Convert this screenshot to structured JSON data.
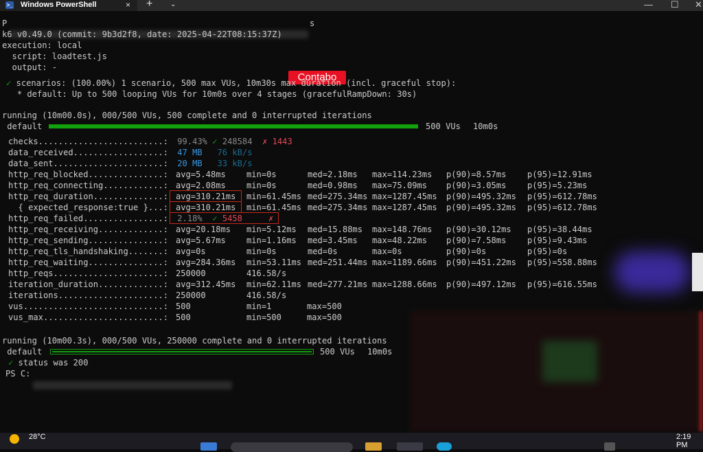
{
  "window": {
    "tab_title": "Windows PowerShell",
    "tab_close": "×",
    "new_tab": "+",
    "tab_menu": "⌄",
    "minimize": "—",
    "maximize": "☐",
    "close": "✕"
  },
  "header": {
    "prompt_partial": "P",
    "cmd_tail": "s",
    "version": "k6 v0.49.0 (commit: 9b3d2f8, date: 2025-04-22T08:15:37Z)",
    "execution": "execution: local",
    "script": "  script: loadtest.js",
    "output": "  output: -",
    "label": "Contabo"
  },
  "scenarios": {
    "check": "✓",
    "line": " scenarios: (100.00%) 1 scenario, 500 max VUs, 10m30s max duration (incl. graceful stop):",
    "default": "   * default: Up to 500 looping VUs for 10m0s over 4 stages (gracefulRampDown: 30s)"
  },
  "progress1": {
    "running": "running (10m00.0s), 000/500 VUs, 500 complete and 0 interrupted iterations",
    "label": " default",
    "vus": "500 VUs",
    "time": "10m0s"
  },
  "metrics": {
    "checks": {
      "name": "checks.........................: ",
      "pct": "99.43%",
      "ok": "✓",
      "pass": "248584",
      "fail_mark": "✗",
      "fail": "1443"
    },
    "data_received": {
      "name": "data_received..................: ",
      "amount": "47 MB",
      "rate": "76 kB/s"
    },
    "data_sent": {
      "name": "data_sent......................: ",
      "amount": "20 MB",
      "rate": "33 kB/s"
    },
    "rows": [
      {
        "name": "http_req_blocked...............: ",
        "avg": "avg=5.48ms",
        "min": "min=0s",
        "med": "med=2.18ms",
        "max": "max=114.23ms",
        "p90": "p(90)=8.57ms",
        "p95": "p(95)=12.91ms"
      },
      {
        "name": "http_req_connecting............: ",
        "avg": "avg=2.08ms",
        "min": "min=0s",
        "med": "med=0.98ms",
        "max": "max=75.09ms",
        "p90": "p(90)=3.05ms",
        "p95": "p(95)=5.23ms"
      },
      {
        "name": "http_req_duration..............: ",
        "avg": "avg=310.21ms",
        "min": "min=61.45ms",
        "med": "med=275.34ms",
        "max": "max=1287.45ms",
        "p90": "p(90)=495.32ms",
        "p95": "p(95)=612.78ms"
      },
      {
        "name": "  { expected_response:true }...: ",
        "avg": "avg=310.21ms",
        "min": "min=61.45ms",
        "med": "med=275.34ms",
        "max": "max=1287.45ms",
        "p90": "p(90)=495.32ms",
        "p95": "p(95)=612.78ms"
      }
    ],
    "failed": {
      "name": "http_req_failed................: ",
      "pct": "2.18%",
      "ok": "✓",
      "count": "5458",
      "fail_mark": "✗"
    },
    "rows2": [
      {
        "name": "http_req_receiving.............: ",
        "avg": "avg=20.18ms",
        "min": "min=5.12ms",
        "med": "med=15.88ms",
        "max": "max=148.76ms",
        "p90": "p(90)=30.12ms",
        "p95": "p(95)=38.44ms"
      },
      {
        "name": "http_req_sending...............: ",
        "avg": "avg=5.67ms",
        "min": "min=1.16ms",
        "med": "med=3.45ms",
        "max": "max=48.22ms",
        "p90": "p(90)=7.58ms",
        "p95": "p(95)=9.43ms"
      },
      {
        "name": "http_req_tls_handshaking.......: ",
        "avg": "avg=0s",
        "min": "min=0s",
        "med": "med=0s",
        "max": "max=0s",
        "p90": "p(90)=0s",
        "p95": "p(95)=0s"
      },
      {
        "name": "http_req_waiting...............: ",
        "avg": "avg=284.36ms",
        "min": "min=53.11ms",
        "med": "med=251.44ms",
        "max": "max=1189.66ms",
        "p90": "p(90)=451.22ms",
        "p95": "p(95)=558.88ms"
      }
    ],
    "http_reqs": {
      "name": "http_reqs......................: ",
      "count": "250000",
      "rate": "416.58/s"
    },
    "iteration_duration": {
      "name": "iteration_duration.............: ",
      "avg": "avg=312.45ms",
      "min": "min=62.11ms",
      "med": "med=277.21ms",
      "max": "max=1288.66ms",
      "p90": "p(90)=497.12ms",
      "p95": "p(95)=616.55ms"
    },
    "iterations": {
      "name": "iterations.....................: ",
      "count": "250000",
      "rate": "416.58/s"
    },
    "vus": {
      "name": "vus............................: ",
      "val": "500",
      "min": "min=1",
      "max": "max=500"
    },
    "vus_max": {
      "name": "vus_max........................: ",
      "val": "500",
      "min": "min=500",
      "max": "max=500"
    }
  },
  "progress2": {
    "running": "running (10m00.3s), 000/500 VUs, 250000 complete and 0 interrupted iterations",
    "label": " default",
    "vus": "500 VUs",
    "time": "10m0s",
    "check": "✓",
    "status": " status was 200"
  },
  "prompt": {
    "text": "PS C:"
  },
  "taskbar": {
    "temp": "28°C",
    "time": "2:19 PM"
  },
  "colors": {
    "green": "#13a10e",
    "red": "#e74856",
    "cyan": "#3a96dd",
    "highlight": "#c42b1c",
    "label_bg": "#e81123"
  }
}
